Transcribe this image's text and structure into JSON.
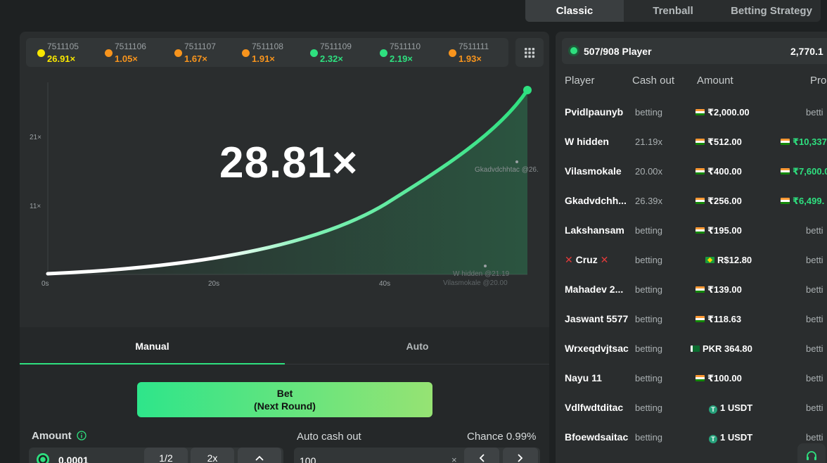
{
  "top_tabs": [
    {
      "label": "Classic",
      "active": true
    },
    {
      "label": "Trenball",
      "active": false
    },
    {
      "label": "Betting Strategy",
      "active": false
    }
  ],
  "history": [
    {
      "round": "7511105",
      "multiplier": "26.91×",
      "color": "#f7e600"
    },
    {
      "round": "7511106",
      "multiplier": "1.05×",
      "color": "#f7941d"
    },
    {
      "round": "7511107",
      "multiplier": "1.67×",
      "color": "#f7941d"
    },
    {
      "round": "7511108",
      "multiplier": "1.91×",
      "color": "#f7941d"
    },
    {
      "round": "7511109",
      "multiplier": "2.32×",
      "color": "#2ee07f"
    },
    {
      "round": "7511110",
      "multiplier": "2.19×",
      "color": "#2ee07f"
    },
    {
      "round": "7511111",
      "multiplier": "1.93×",
      "color": "#f7941d"
    }
  ],
  "game": {
    "current_multiplier": "28.81×",
    "y_ticks": [
      "21×",
      "11×"
    ],
    "x_ticks": [
      "0s",
      "20s",
      "40s"
    ],
    "cashout_labels": [
      "Gkadvdchhtac @26.",
      "W hidden @21.19",
      "Vilasmokale @20.00"
    ]
  },
  "mode_tabs": {
    "manual": "Manual",
    "auto": "Auto"
  },
  "bet": {
    "button_line1": "Bet",
    "button_line2": "(Next Round)",
    "amount_label": "Amount",
    "amount_value": "0.0001",
    "half_label": "1/2",
    "double_label": "2x",
    "auto_cashout_label": "Auto cash out",
    "auto_cashout_value": "100",
    "chance_label": "Chance 0.99%"
  },
  "players_panel": {
    "count": "507/908 Player",
    "total": "2,770.1",
    "columns": {
      "player": "Player",
      "cashout": "Cash out",
      "amount": "Amount",
      "profit": "Pro"
    },
    "rows": [
      {
        "name": "Pvidlpaunyb",
        "cashout": "betting",
        "amount": "₹2,000.00",
        "flag": "in",
        "profit": "betti",
        "profit_flag": ""
      },
      {
        "name": "W hidden",
        "cashout": "21.19x",
        "amount": "₹512.00",
        "flag": "in",
        "profit": "₹10,337.",
        "profit_flag": "in"
      },
      {
        "name": "Vilasmokale",
        "cashout": "20.00x",
        "amount": "₹400.00",
        "flag": "in",
        "profit": "₹7,600.0",
        "profit_flag": "in"
      },
      {
        "name": "Gkadvdchh...",
        "cashout": "26.39x",
        "amount": "₹256.00",
        "flag": "in",
        "profit": "₹6,499.",
        "profit_flag": "in"
      },
      {
        "name": "Lakshansam",
        "cashout": "betting",
        "amount": "₹195.00",
        "flag": "in",
        "profit": "betti",
        "profit_flag": ""
      },
      {
        "name": "Cruz",
        "cashout": "betting",
        "amount": "R$12.80",
        "flag": "br",
        "profit": "betti",
        "profit_flag": ""
      },
      {
        "name": "Mahadev 2...",
        "cashout": "betting",
        "amount": "₹139.00",
        "flag": "in",
        "profit": "betti",
        "profit_flag": ""
      },
      {
        "name": "Jaswant 5577",
        "cashout": "betting",
        "amount": "₹118.63",
        "flag": "in",
        "profit": "betti",
        "profit_flag": ""
      },
      {
        "name": "Wrxeqdvjtsac",
        "cashout": "betting",
        "amount": "PKR 364.80",
        "flag": "pk",
        "profit": "betti",
        "profit_flag": ""
      },
      {
        "name": "Nayu 11",
        "cashout": "betting",
        "amount": "₹100.00",
        "flag": "in",
        "profit": "betti",
        "profit_flag": ""
      },
      {
        "name": "Vdlfwdtditac",
        "cashout": "betting",
        "amount": "1 USDT",
        "flag": "usdt",
        "profit": "betti",
        "profit_flag": ""
      },
      {
        "name": "Bfoewdsaitac",
        "cashout": "betting",
        "amount": "1 USDT",
        "flag": "usdt",
        "profit": "betti",
        "profit_flag": ""
      }
    ]
  },
  "colors": {
    "accent": "#2ee07f",
    "panel": "#2a2d2e",
    "background": "#1e2122"
  }
}
